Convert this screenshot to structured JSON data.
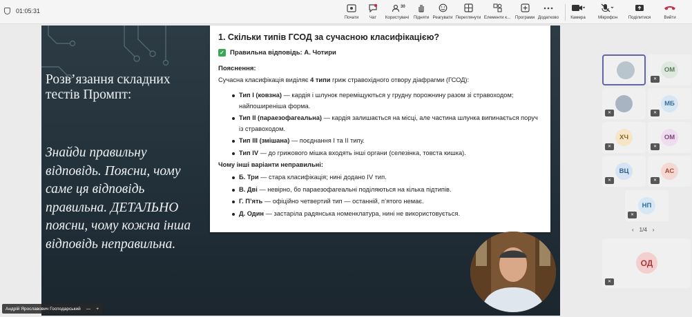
{
  "topbar": {
    "timer": "01:05:31",
    "buttons": [
      {
        "label": "Почати",
        "icon": "record-icon"
      },
      {
        "label": "Чат",
        "icon": "chat-icon"
      },
      {
        "label": "Користувачі",
        "icon": "people-icon",
        "count": "30"
      },
      {
        "label": "Підняти",
        "icon": "raise-hand-icon"
      },
      {
        "label": "Реагувати",
        "icon": "react-icon"
      },
      {
        "label": "Переглянути",
        "icon": "view-icon"
      },
      {
        "label": "Елементи к...",
        "icon": "apps-icon"
      },
      {
        "label": "Програми",
        "icon": "add-app-icon"
      },
      {
        "label": "Додатково",
        "icon": "more-icon"
      },
      {
        "label": "Камера",
        "icon": "camera-icon"
      },
      {
        "label": "Мікрофон",
        "icon": "mic-icon"
      },
      {
        "label": "Поділитися",
        "icon": "share-icon"
      },
      {
        "label": "Вийти",
        "icon": "hangup-icon"
      }
    ],
    "accent": "#c4314b"
  },
  "slide": {
    "title": "Розв’язання складних тестів Промпт:",
    "body": "Знайди правильну відповідь. Поясни, чому саме ця відповідь правильна. ДЕТАЛЬНО поясни, чому кожна інша відповідь неправильна."
  },
  "card": {
    "question": "1. Скільки типів ГСОД за сучасною класифікацією?",
    "correct": "Правильна відповідь: А. Чотири",
    "explanation_title": "Пояснення:",
    "intro": {
      "a": "Сучасна класифікація виділяє ",
      "b": "4 типи",
      "c": " гриж стравохідного отвору діафрагми (ГСОД):"
    },
    "types": [
      {
        "b": "Тип I (ковзна)",
        "t": " — кардія і шлунок переміщуються у грудну порожнину разом зі стравоходом; найпоширеніша форма."
      },
      {
        "b": "Тип II (параезофагеальна)",
        "t": " — кардія залишається на місці, але частина шлунка випинається поруч із стравоходом."
      },
      {
        "b": "Тип III (змішана)",
        "t": " — поєднання I та II типу."
      },
      {
        "b": "Тип IV",
        "t": " — до грижового мішка входять інші органи (селезінка, товста кишка)."
      }
    ],
    "wrong_title": "Чому інші варіанти неправильні:",
    "wrong": [
      {
        "b": "Б. Три",
        "t": " — стара класифікація; нині додано IV тип."
      },
      {
        "b": "В. Дві",
        "t": " — невірно, бо параезофагеальні поділяються на кілька підтипів."
      },
      {
        "b": "Г. П’ять",
        "t": " — офіційно четвертий тип — останній, п’ятого немає."
      },
      {
        "b": "Д. Один",
        "t": " — застаріла радянська номенклатура, нині не використовується."
      }
    ]
  },
  "presenter": {
    "name": "Андрій Ярославович Господарський"
  },
  "participants": [
    {
      "initials": "",
      "photo": true,
      "color": "#d9d9d9"
    },
    {
      "initials": "ОМ",
      "color": "#dfe8df",
      "text": "#5a7a5a"
    },
    {
      "initials": "",
      "photo": true,
      "color": "#d9d9d9"
    },
    {
      "initials": "МБ",
      "color": "#d7e6f3",
      "text": "#3c6e9a"
    },
    {
      "initials": "ХЧ",
      "color": "#f6e6c8",
      "text": "#8a6420"
    },
    {
      "initials": "ОМ",
      "color": "#efdcef",
      "text": "#7a4a7a"
    },
    {
      "initials": "ВЦ",
      "color": "#d6e3f2",
      "text": "#2f5f8f"
    },
    {
      "initials": "АС",
      "color": "#f5d8d2",
      "text": "#a24a3a"
    },
    {
      "initials": "НП",
      "color": "#d6e8f5",
      "text": "#2f6d9a"
    }
  ],
  "pager": {
    "label": "1/4"
  },
  "spotlight": {
    "initials": "ОД",
    "color": "#f4cfcf",
    "text": "#a83a3a"
  }
}
